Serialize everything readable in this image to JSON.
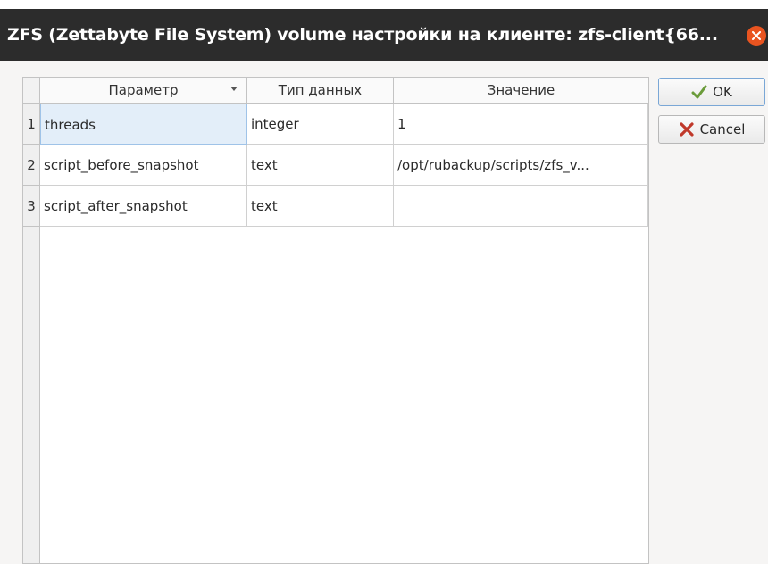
{
  "window": {
    "title": "ZFS (Zettabyte File System) volume настройки на клиенте: zfs-client{66..."
  },
  "table": {
    "columns": [
      "Параметр",
      "Тип данных",
      "Значение"
    ],
    "rows": [
      {
        "num": "1",
        "param": "threads",
        "type": "integer",
        "value": "1"
      },
      {
        "num": "2",
        "param": "script_before_snapshot",
        "type": "text",
        "value": "/opt/rubackup/scripts/zfs_v..."
      },
      {
        "num": "3",
        "param": "script_after_snapshot",
        "type": "text",
        "value": ""
      }
    ]
  },
  "buttons": {
    "ok_label": "OK",
    "cancel_label": "Cancel"
  },
  "colors": {
    "titlebar": "#2c2c2c",
    "close_button": "#e95420",
    "selected_cell": "#e3eef9",
    "ok_icon": "#6a9b3a",
    "cancel_icon": "#c0392b"
  },
  "icons": [
    "close-icon",
    "sort-indicator-icon",
    "ok-check-icon",
    "cancel-x-icon"
  ]
}
